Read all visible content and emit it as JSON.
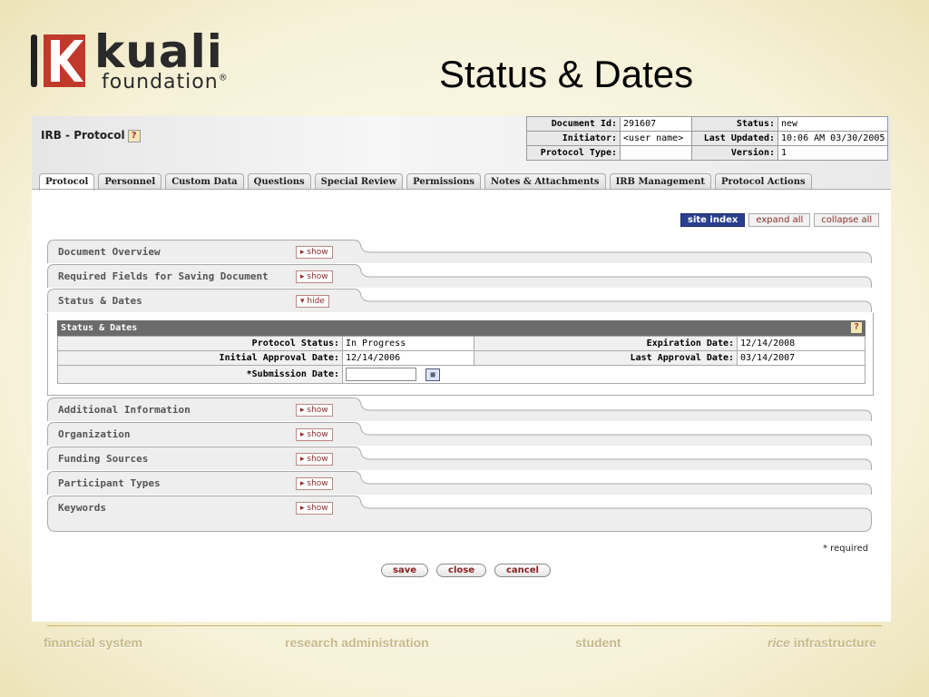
{
  "slide": {
    "title": "Status & Dates",
    "logo_word": "kuali",
    "logo_sub": "foundation",
    "logo_mark": "®"
  },
  "header": {
    "doc_title": "IRB - Protocol",
    "help": "?",
    "info": [
      {
        "label": "Document Id:",
        "value": "291607",
        "label2": "Status:",
        "value2": "new"
      },
      {
        "label": "Initiator:",
        "value": "<user name>",
        "label2": "Last Updated:",
        "value2": "10:06 AM 03/30/2005"
      },
      {
        "label": "Protocol Type:",
        "value": "",
        "label2": "Version:",
        "value2": "1"
      }
    ]
  },
  "tabs": [
    "Protocol",
    "Personnel",
    "Custom Data",
    "Questions",
    "Special Review",
    "Permissions",
    "Notes & Attachments",
    "IRB Management",
    "Protocol Actions"
  ],
  "top_buttons": {
    "site_index": "site index",
    "expand_all": "expand all",
    "collapse_all": "collapse all"
  },
  "sections_top": [
    {
      "title": "Document Overview",
      "toggle": "▸ show"
    },
    {
      "title": "Required Fields for Saving Document",
      "toggle": "▸ show"
    },
    {
      "title": "Status & Dates",
      "toggle": "▾ hide"
    }
  ],
  "status_dates": {
    "header": "Status & Dates",
    "help": "?",
    "protocol_status_label": "Protocol Status:",
    "protocol_status": "In Progress",
    "expiration_label": "Expiration Date:",
    "expiration": "12/14/2008",
    "initial_label": "Initial Approval Date:",
    "initial": "12/14/2006",
    "last_label": "Last Approval Date:",
    "last": "03/14/2007",
    "submission_label": "*Submission Date:",
    "submission": ""
  },
  "sections_bottom": [
    {
      "title": "Additional Information",
      "toggle": "▸ show"
    },
    {
      "title": "Organization",
      "toggle": "▸ show"
    },
    {
      "title": "Funding Sources",
      "toggle": "▸ show"
    },
    {
      "title": "Participant Types",
      "toggle": "▸ show"
    },
    {
      "title": "Keywords",
      "toggle": "▸ show"
    }
  ],
  "required_note": "* required",
  "actions": {
    "save": "save",
    "close": "close",
    "cancel": "cancel"
  },
  "footer": {
    "a": "financial system",
    "b": "research administration",
    "c": "student",
    "d_italic": "rice",
    "d": " infrastructure"
  },
  "colors": {
    "accent": "#2a3f8f",
    "brand_red": "#c0392b",
    "link_red": "#8a2a2a"
  }
}
